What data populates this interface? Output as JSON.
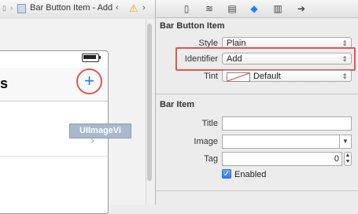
{
  "editor": {
    "breadcrumb": "Bar Button Item - Add",
    "nav_title_partial": "s",
    "image_view_label": "UIImageVi"
  },
  "inspector": {
    "bar_button_item": {
      "header": "Bar Button Item",
      "style_label": "Style",
      "style_value": "Plain",
      "identifier_label": "Identifier",
      "identifier_value": "Add",
      "tint_label": "Tint",
      "tint_value": "Default"
    },
    "bar_item": {
      "header": "Bar Item",
      "title_label": "Title",
      "title_value": "",
      "image_label": "Image",
      "image_value": "",
      "tag_label": "Tag",
      "tag_value": "0",
      "enabled_label": "Enabled",
      "enabled_checked": true
    }
  },
  "colors": {
    "highlight": "#e2574c",
    "accent": "#1a82fb"
  }
}
